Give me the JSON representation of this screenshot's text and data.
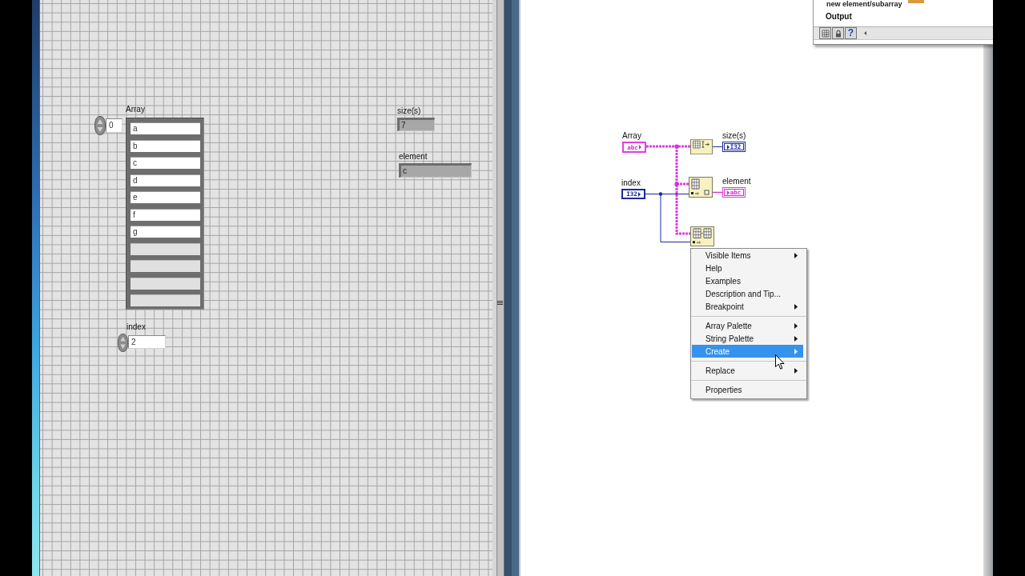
{
  "front_panel": {
    "array": {
      "label": "Array",
      "index_value": "0",
      "elements": [
        {
          "value": "a",
          "disabled": false
        },
        {
          "value": "b",
          "disabled": false
        },
        {
          "value": "c",
          "disabled": false
        },
        {
          "value": "d",
          "disabled": false
        },
        {
          "value": "e",
          "disabled": false
        },
        {
          "value": "f",
          "disabled": false
        },
        {
          "value": "g",
          "disabled": false
        },
        {
          "disabled": true
        },
        {
          "disabled": true
        },
        {
          "disabled": true
        },
        {
          "disabled": true
        }
      ]
    },
    "index": {
      "label": "index",
      "value": "2"
    },
    "size_indicator": {
      "label": "size(s)",
      "value": "7"
    },
    "element_indicator": {
      "label": "element",
      "value": "c"
    }
  },
  "block_diagram": {
    "terminals": [
      {
        "label": "Array",
        "type_label": "abc",
        "kind": "string_control"
      },
      {
        "label": "index",
        "type_label": "I32",
        "kind": "integer_control"
      },
      {
        "label": "size(s)",
        "type_label": "I32",
        "kind": "integer_indicator"
      },
      {
        "label": "element",
        "type_label": "abc",
        "kind": "string_indicator"
      }
    ],
    "nodes": [
      {
        "kind": "size"
      },
      {
        "kind": "index"
      },
      {
        "kind": "insert"
      }
    ]
  },
  "context_menu": {
    "groups": [
      {
        "items": [
          {
            "label": "Visible Items",
            "submenu": true,
            "selected": false
          },
          {
            "label": "Help",
            "submenu": false,
            "selected": false
          },
          {
            "label": "Examples",
            "submenu": false,
            "selected": false
          },
          {
            "label": "Description and Tip...",
            "submenu": false,
            "selected": false
          },
          {
            "label": "Breakpoint",
            "submenu": true,
            "selected": false
          }
        ]
      },
      {
        "items": [
          {
            "label": "Array Palette",
            "submenu": true,
            "selected": false
          },
          {
            "label": "String Palette",
            "submenu": true,
            "selected": false
          },
          {
            "label": "Create",
            "submenu": true,
            "selected": true
          }
        ]
      },
      {
        "items": [
          {
            "label": "Replace",
            "submenu": true,
            "selected": false
          }
        ]
      },
      {
        "items": [
          {
            "label": "Properties",
            "submenu": false,
            "selected": false
          }
        ]
      }
    ]
  },
  "context_help": {
    "terminal_label": "new element/subarray",
    "section": "Output",
    "help_button": "?"
  }
}
